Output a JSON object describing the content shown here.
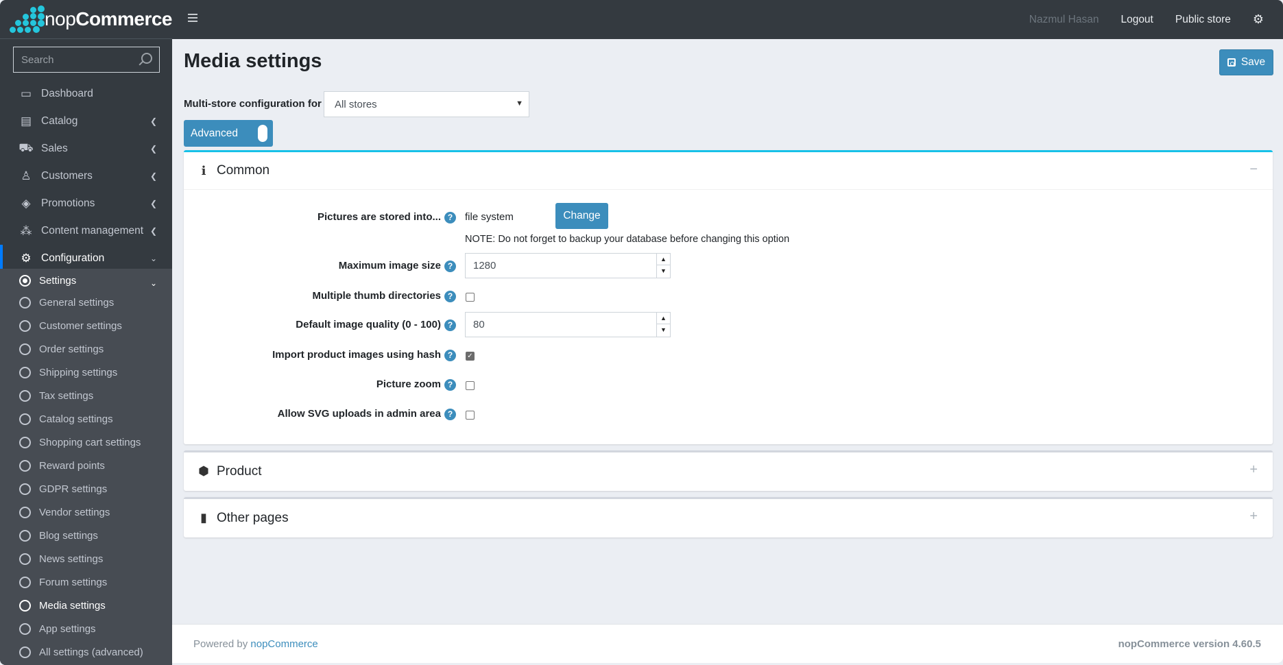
{
  "header": {
    "brand_light": "nop",
    "brand_bold": "Commerce",
    "user_name": "Nazmul Hasan",
    "logout": "Logout",
    "public_store": "Public store",
    "menu_icon": "hamburger-icon",
    "settings_icon": "gears-icon"
  },
  "sidebar": {
    "search_placeholder": "Search",
    "items": [
      {
        "label": "Dashboard",
        "icon": "monitor-icon",
        "glyph": "🖥"
      },
      {
        "label": "Catalog",
        "icon": "book-icon",
        "glyph": "▤"
      },
      {
        "label": "Sales",
        "icon": "cart-icon",
        "glyph": "🛒"
      },
      {
        "label": "Customers",
        "icon": "user-icon",
        "glyph": "👤"
      },
      {
        "label": "Promotions",
        "icon": "tags-icon",
        "glyph": "🏷"
      },
      {
        "label": "Content management",
        "icon": "cubes-icon",
        "glyph": "⧉"
      },
      {
        "label": "Configuration",
        "icon": "gears-icon",
        "glyph": "⚙"
      }
    ],
    "settings_label": "Settings",
    "sub_items": [
      "General settings",
      "Customer settings",
      "Order settings",
      "Shipping settings",
      "Tax settings",
      "Catalog settings",
      "Shopping cart settings",
      "Reward points",
      "GDPR settings",
      "Vendor settings",
      "Blog settings",
      "News settings",
      "Forum settings",
      "Media settings",
      "App settings",
      "All settings (advanced)"
    ],
    "current_sub_item": "Media settings"
  },
  "page": {
    "title": "Media settings",
    "save_label": "Save",
    "multistore_label": "Multi-store configuration for",
    "multistore_value": "All stores",
    "advanced_label": "Advanced",
    "advanced_on": true
  },
  "panels": {
    "common": {
      "title": "Common",
      "toggle": "−",
      "fields": {
        "storage_label": "Pictures are stored into...",
        "storage_value": "file system",
        "change_label": "Change",
        "note": "NOTE: Do not forget to backup your database before changing this option",
        "max_size_label": "Maximum image size",
        "max_size_value": "1280",
        "thumb_dirs_label": "Multiple thumb directories",
        "thumb_dirs_checked": false,
        "quality_label": "Default image quality (0 - 100)",
        "quality_value": "80",
        "hash_label": "Import product images using hash",
        "hash_checked": true,
        "zoom_label": "Picture zoom",
        "zoom_checked": false,
        "svg_label": "Allow SVG uploads in admin area",
        "svg_checked": false
      }
    },
    "product": {
      "title": "Product",
      "toggle": "+"
    },
    "other": {
      "title": "Other pages",
      "toggle": "+"
    }
  },
  "footer": {
    "powered_by": "Powered by ",
    "powered_link": "nopCommerce",
    "version": "nopCommerce version 4.60.5"
  },
  "colors": {
    "accent": "#3c8dbc",
    "sidebar_bg": "#343a40",
    "panel_active_border": "#17c1e8",
    "brand_dots": "#24c6dc"
  }
}
